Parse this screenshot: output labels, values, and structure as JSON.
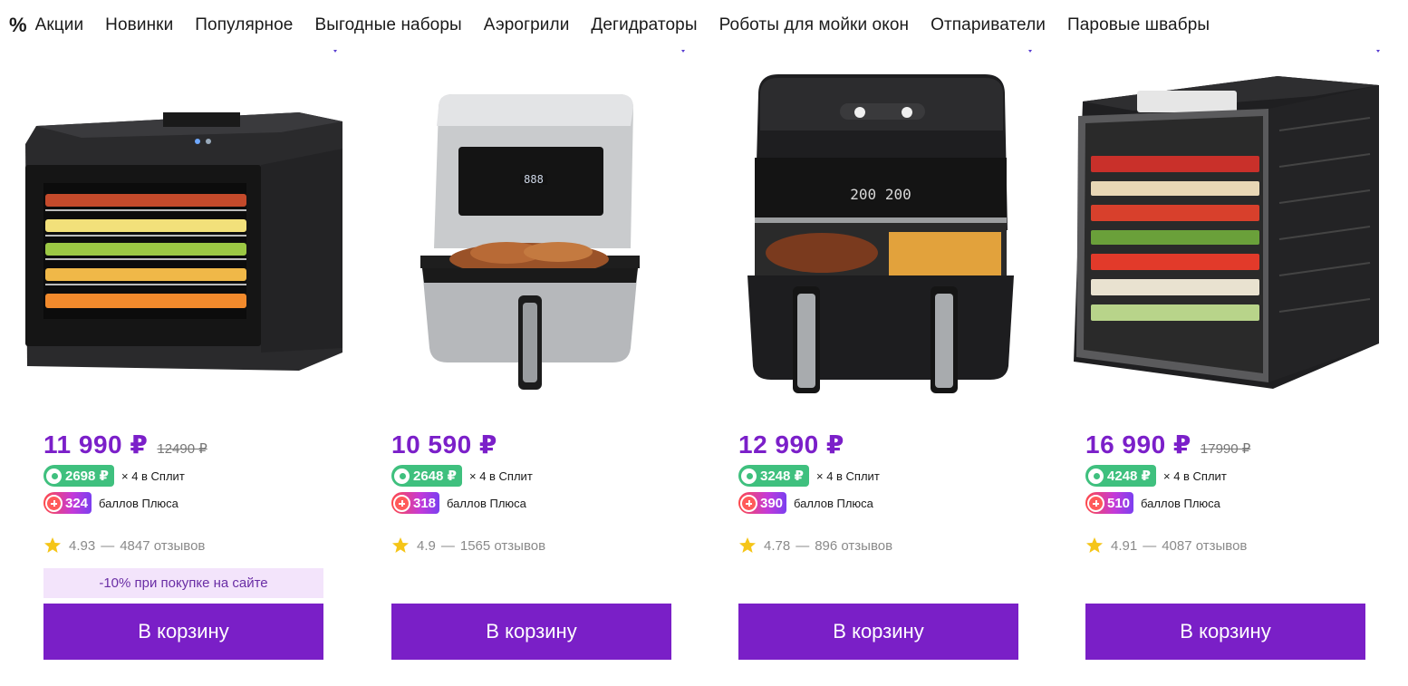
{
  "nav": {
    "percent_symbol": "%",
    "items": [
      {
        "label": "Акции"
      },
      {
        "label": "Новинки"
      },
      {
        "label": "Популярное"
      },
      {
        "label": "Выгодные наборы"
      },
      {
        "label": "Аэрогрили"
      },
      {
        "label": "Дегидраторы"
      },
      {
        "label": "Роботы для мойки окон"
      },
      {
        "label": "Отпариватели"
      },
      {
        "label": "Паровые швабры"
      }
    ]
  },
  "colors": {
    "accent": "#7a1fc7",
    "price": "#7b1fc9",
    "split_green": "#3fc07e",
    "promo_bg": "#f3e4fb",
    "star": "#f5c518"
  },
  "products": [
    {
      "image": "food-dehydrator-kitfort",
      "price": "11 990 ₽",
      "old_price": "12490 ₽",
      "split_amount": "2698 ₽",
      "split_text": "× 4 в Сплит",
      "plus_points": "324",
      "plus_text": "баллов Плюса",
      "rating": "4.93",
      "rating_sep": "—",
      "reviews": "4847 отзывов",
      "promo": "-10% при покупке на сайте",
      "cart_label": "В корзину"
    },
    {
      "image": "air-fryer-kitfort-steel",
      "price": "10 590 ₽",
      "old_price": "",
      "split_amount": "2648 ₽",
      "split_text": "× 4 в Сплит",
      "plus_points": "318",
      "plus_text": "баллов Плюса",
      "rating": "4.9",
      "rating_sep": "—",
      "reviews": "1565 отзывов",
      "promo": "",
      "cart_label": "В корзину"
    },
    {
      "image": "dual-air-fryer-kitfort",
      "price": "12 990 ₽",
      "old_price": "",
      "split_amount": "3248 ₽",
      "split_text": "× 4 в Сплит",
      "plus_points": "390",
      "plus_text": "баллов Плюса",
      "rating": "4.78",
      "rating_sep": "—",
      "reviews": "896 отзывов",
      "promo": "",
      "cart_label": "В корзину"
    },
    {
      "image": "large-food-dehydrator",
      "price": "16 990 ₽",
      "old_price": "17990 ₽",
      "split_amount": "4248 ₽",
      "split_text": "× 4 в Сплит",
      "plus_points": "510",
      "plus_text": "баллов Плюса",
      "rating": "4.91",
      "rating_sep": "—",
      "reviews": "4087 отзывов",
      "promo": "",
      "cart_label": "В корзину"
    }
  ]
}
